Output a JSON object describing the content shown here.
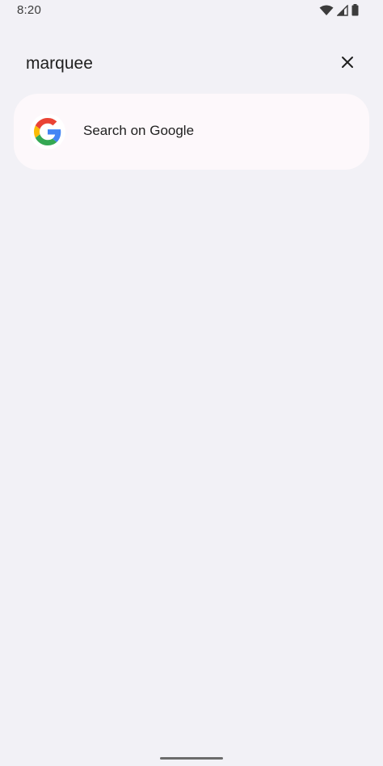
{
  "status_bar": {
    "time": "8:20",
    "icons": [
      "wifi-icon",
      "signal-icon",
      "battery-icon"
    ]
  },
  "search": {
    "query": "marquee",
    "clear_icon": "close-icon"
  },
  "results": [
    {
      "icon": "google-logo-icon",
      "label": "Search on Google"
    }
  ],
  "colors": {
    "background": "#f2f1f6",
    "card": "#fdf8fb",
    "google_blue": "#4285F4",
    "google_red": "#EA4335",
    "google_yellow": "#FBBC05",
    "google_green": "#34A853"
  }
}
